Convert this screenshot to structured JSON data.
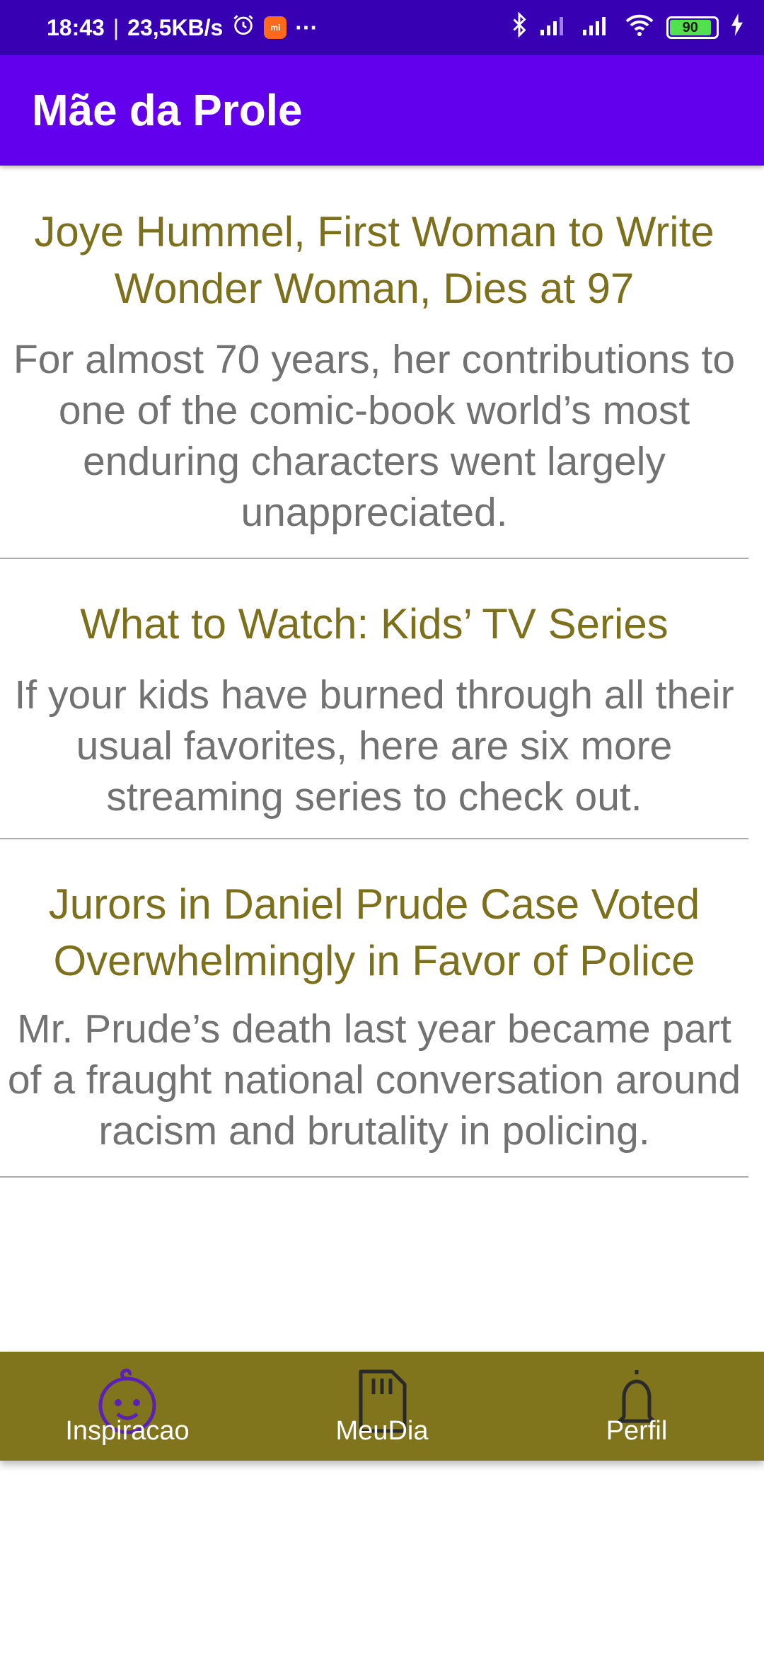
{
  "status_bar": {
    "time": "18:43",
    "separator": "|",
    "speed": "23,5KB/s",
    "mi_label": "mi",
    "more": "···",
    "battery": "90",
    "battery_level": 0.9
  },
  "app_bar": {
    "title": "Mãe da Prole"
  },
  "feed": [
    {
      "title": "Joye Hummel, First Woman to Write Wonder Woman, Dies at 97",
      "description": "For almost 70 years, her contributions to one of the comic-book world’s most enduring characters went largely unappreciated."
    },
    {
      "title": "What to Watch: Kids’ TV Series",
      "description": "If your kids have burned through all their usual favorites, here are six more streaming series to check out."
    },
    {
      "title": "Jurors in Daniel Prude Case Voted Overwhelmingly in Favor of Police",
      "description": "Mr. Prude’s death last year became part of a fraught national conversation around racism and brutality in policing."
    }
  ],
  "bottom_nav": {
    "items": [
      {
        "label": "Inspiracao",
        "icon": "baby-icon"
      },
      {
        "label": "MeuDia",
        "icon": "sd-card-icon"
      },
      {
        "label": "Perfil",
        "icon": "bell-icon"
      }
    ]
  },
  "colors": {
    "status_bar": "#3700b3",
    "app_bar": "#6200ee",
    "title_text": "#7c701c",
    "body_text": "#727272",
    "bottom_nav": "#80751c",
    "baby_icon": "#5b21b6"
  }
}
